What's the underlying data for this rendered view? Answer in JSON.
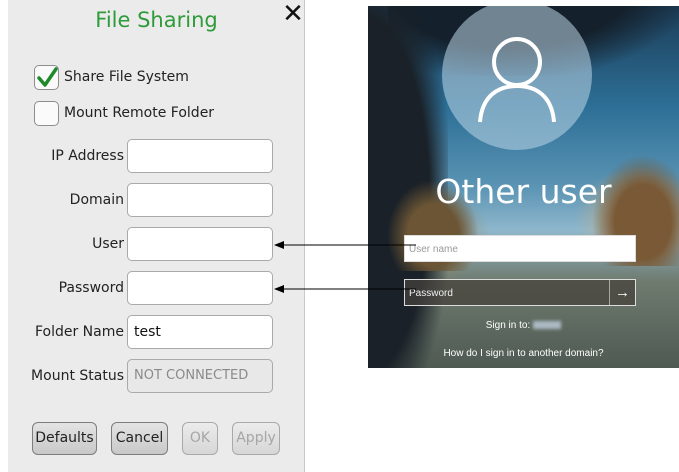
{
  "dialog": {
    "title": "File Sharing",
    "close_glyph": "✕",
    "checkboxes": [
      {
        "label": "Share File System",
        "checked": true
      },
      {
        "label": "Mount Remote Folder",
        "checked": false
      }
    ],
    "fields": {
      "ip_address": {
        "label": "IP Address",
        "value": ""
      },
      "domain": {
        "label": "Domain",
        "value": ""
      },
      "user": {
        "label": "User",
        "value": ""
      },
      "password": {
        "label": "Password",
        "value": ""
      },
      "folder_name": {
        "label": "Folder Name",
        "value": "test"
      },
      "mount_status": {
        "label": "Mount Status",
        "value": "NOT CONNECTED"
      }
    },
    "buttons": {
      "defaults": "Defaults",
      "cancel": "Cancel",
      "ok": "OK",
      "apply": "Apply"
    },
    "accent_color": "#2e9b3a"
  },
  "login": {
    "heading": "Other user",
    "username_placeholder": "User name",
    "password_placeholder": "Password",
    "submit_glyph": "→",
    "sign_in_to": "Sign in to:",
    "other_domain_link": "How do I sign in to another domain?",
    "avatar_icon": "user-silhouette-icon"
  }
}
